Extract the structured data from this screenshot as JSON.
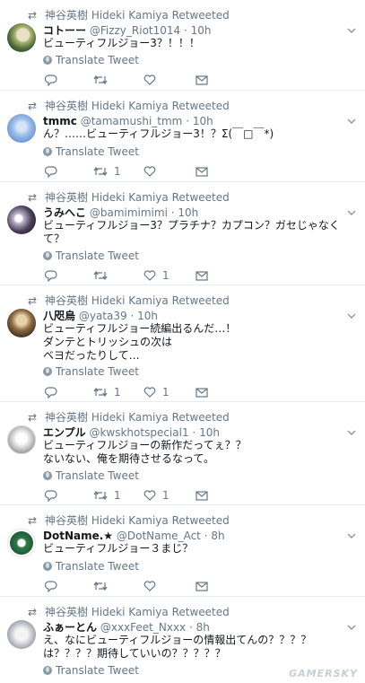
{
  "retweeted_by": "神谷英樹 Hideki Kamiya Retweeted",
  "translate_label": "Translate Tweet",
  "tweets": [
    {
      "name": "コトーー",
      "handle": "@Fizzy_Riot1014",
      "time": "10h",
      "text": "ビューティフルジョー3？！！！",
      "retweets": "",
      "likes": ""
    },
    {
      "name": "tmmc",
      "handle": "@tamamushi_tmm",
      "time": "10h",
      "text": "ん？……ビューティフルジョー3！？Σ(￣□￣*)",
      "retweets": "1",
      "likes": ""
    },
    {
      "name": "うみへこ",
      "handle": "@bamimimimi",
      "time": "10h",
      "text": "ビューティフルジョー3？プラチナ？カプコン？ガセじゃなくて？",
      "retweets": "",
      "likes": "1"
    },
    {
      "name": "八咫烏",
      "handle": "@yata39",
      "time": "10h",
      "text": "ビューティフルジョー続編出るんだ…！\nダンテとトリッシュの次は\nベヨだったりして…",
      "retweets": "1",
      "likes": "1"
    },
    {
      "name": "エンプル",
      "handle": "@kwskhotspecial1",
      "time": "10h",
      "text": "ビューティフルジョーの新作だってぇ？？\nないない、俺を期待させるなって。",
      "retweets": "1",
      "likes": "1"
    },
    {
      "name": "DotName.★",
      "handle": "@DotName_Act",
      "time": "8h",
      "text": "ビューティフルジョー３まじ？",
      "retweets": "",
      "likes": ""
    },
    {
      "name": "ふぁーとん",
      "handle": "@xxxFeet_Nxxx",
      "time": "8h",
      "text": "え、なにビューティフルジョーの情報出てんの？？？？\nは？？？？期待していいの？？？？？",
      "retweets": "",
      "likes": ""
    }
  ],
  "watermark": "GAMERSKY",
  "icons": {
    "retweet": "retweet-icon",
    "reply": "reply-icon",
    "like": "heart-icon",
    "message": "envelope-icon",
    "translate": "globe-icon",
    "menu": "chevron-down-icon"
  },
  "colors": {
    "text": "#14171a",
    "muted": "#657786",
    "divider": "#e6ecf0"
  }
}
